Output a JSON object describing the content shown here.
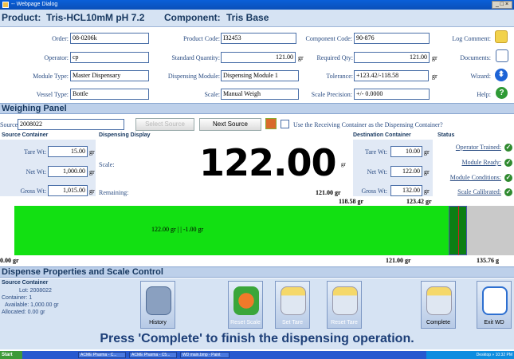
{
  "window": {
    "title": "-- Webpage Dialog",
    "controls": "_ □ ×"
  },
  "header": {
    "product_label": "Product:",
    "product_value": "Tris-HCL10mM pH 7.2",
    "component_label": "Component:",
    "component_value": "Tris Base"
  },
  "form": {
    "order_label": "Order:",
    "order_value": "08-0206k",
    "product_code_label": "Product Code:",
    "product_code_value": "I32453",
    "component_code_label": "Component Code:",
    "component_code_value": "90-876",
    "log_comment_label": "Log Comment:",
    "operator_label": "Operator:",
    "operator_value": "cp",
    "std_qty_label": "Standard Quantity:",
    "std_qty_value": "121.00",
    "std_qty_unit": "gr",
    "req_qty_label": "Required Qty:",
    "req_qty_value": "121.00",
    "req_qty_unit": "gr",
    "documents_label": "Documents:",
    "module_type_label": "Module Type:",
    "module_type_value": "Master Dispensary",
    "dispensing_module_label": "Dispensing Module:",
    "dispensing_module_value": "Dispensing Module 1",
    "tolerance_label": "Tolerance:",
    "tolerance_value": "+123.42/-118.58",
    "tolerance_unit": "gr",
    "wizard_label": "Wizard:",
    "vessel_type_label": "Vessel Type:",
    "vessel_type_value": "Bottle",
    "scale_label": "Scale:",
    "scale_value": "Manual Weigh",
    "scale_precision_label": "Scale Precision:",
    "scale_precision_value": "+/- 0.0000",
    "help_label": "Help:"
  },
  "weighing_panel": {
    "title": "Weighing Panel",
    "source_label": "Source:",
    "source_value": "2008022",
    "select_source": "Select Source",
    "next_source": "Next Source",
    "receiving_checkbox_label": "Use the Receiving Container as the Dispensing Container?",
    "source_container": {
      "title": "Source Container",
      "tare_label": "Tare Wt:",
      "tare_value": "15.00",
      "net_label": "Net Wt:",
      "net_value": "1,000.00",
      "gross_label": "Gross Wt:",
      "gross_value": "1,015.00",
      "unit": "gr"
    },
    "dispensing_display": {
      "title": "Dispensing Display",
      "scale_label": "Scale:",
      "scale_reading": "122.00",
      "scale_unit": "gr",
      "remaining_label": "Remaining:",
      "remaining_value": "121.00 gr"
    },
    "destination_container": {
      "title": "Destination Container",
      "tare_label": "Tare Wt:",
      "tare_value": "10.00",
      "net_label": "Net Wt:",
      "net_value": "122.00",
      "gross_label": "Gross Wt:",
      "gross_value": "132.00",
      "unit": "gr"
    },
    "status": {
      "title": "Status",
      "items": [
        "Operator Trained:",
        "Module Ready:",
        "Module Conditions:",
        "Scale Calibrated:"
      ]
    }
  },
  "gauge": {
    "low_limit_label": "118.58 gr",
    "high_limit_label": "123.42 gr",
    "inside_label": "122.00 gr | | -1.00 gr",
    "min_label": "0.00 gr",
    "target_label": "121.00 gr",
    "max_label": "135.76 g",
    "min_value": 0,
    "max_value": 135.76,
    "target": 121.0,
    "low": 118.58,
    "high": 123.42,
    "current": 122.0
  },
  "dispense": {
    "title": "Dispense Properties and Scale Control",
    "source_container_title": "Source Container",
    "lot": "Lot: 2008022",
    "container": "Container: 1",
    "available": "Available: 1,000.00 gr",
    "allocated": "Allocated: 0.00 gr",
    "buttons": {
      "history": "History",
      "reset_scale": "Reset Scale",
      "set_tare": "Set Tare",
      "reset_tare": "Reset Tare",
      "complete": "Complete",
      "exit_wd": "Exit WD"
    }
  },
  "banner": "Press 'Complete' to finish the dispensing operation.",
  "taskbar": {
    "start": "Start",
    "tasks": [
      "ACME Pharma - C...",
      "ACME Pharma - C5...",
      "WD main.bmp - Paint"
    ],
    "tray": "Desktop » 10:32 PM"
  },
  "colors": {
    "accent": "#16375f",
    "fill_green": "#12e012",
    "tolerance_band": "#0b7f14",
    "label_blue": "#2a4c82"
  }
}
